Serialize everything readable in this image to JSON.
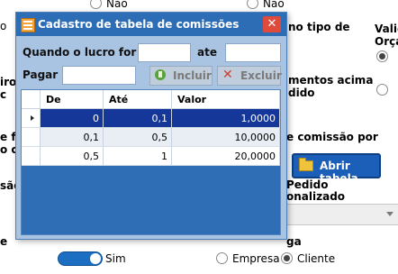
{
  "background": {
    "top_left_label": "o",
    "radio_nao_left": "Não",
    "radio_nao_right": "Não",
    "right_label_validade": "Valid",
    "right_label_orcamento": "Orça",
    "no_tipo_text": "no tipo de",
    "left_iro": "iro",
    "left_c": "c",
    "mentos_acima": "mentos acima",
    "dido": "dido",
    "left_e_fa": "e fa",
    "left_o_c": "o c",
    "comissao_por": "e comissão por",
    "open_button_label": "Abrir tabela",
    "left_sao": "são",
    "pedido": "Pedido",
    "onalizado": "onalizado",
    "left_e": "e",
    "ga": "ga",
    "toggle_label": "Sim",
    "radio_empresa": "Empresa",
    "radio_cliente": "Cliente"
  },
  "dialog": {
    "title": "Cadastro de tabela de comissões",
    "close_glyph": "✕",
    "label_lucro": "Quando o lucro for de",
    "label_ate": "ate",
    "label_pagar": "Pagar",
    "btn_incluir": "Incluir",
    "btn_excluir": "Excluir",
    "grid": {
      "columns": [
        "De",
        "Até",
        "Valor"
      ],
      "rows": [
        {
          "de": "0",
          "ate": "0,1",
          "valor": "1,0000"
        },
        {
          "de": "0,1",
          "ate": "0,5",
          "valor": "10,0000"
        },
        {
          "de": "0,5",
          "ate": "1",
          "valor": "20,0000"
        }
      ]
    }
  },
  "colors": {
    "title_bar": "#2d6db5",
    "dialog_body": "#a9c3e3",
    "selected_row": "#16379a",
    "open_button": "#1b5fb8",
    "close_button": "#e04a3b"
  }
}
